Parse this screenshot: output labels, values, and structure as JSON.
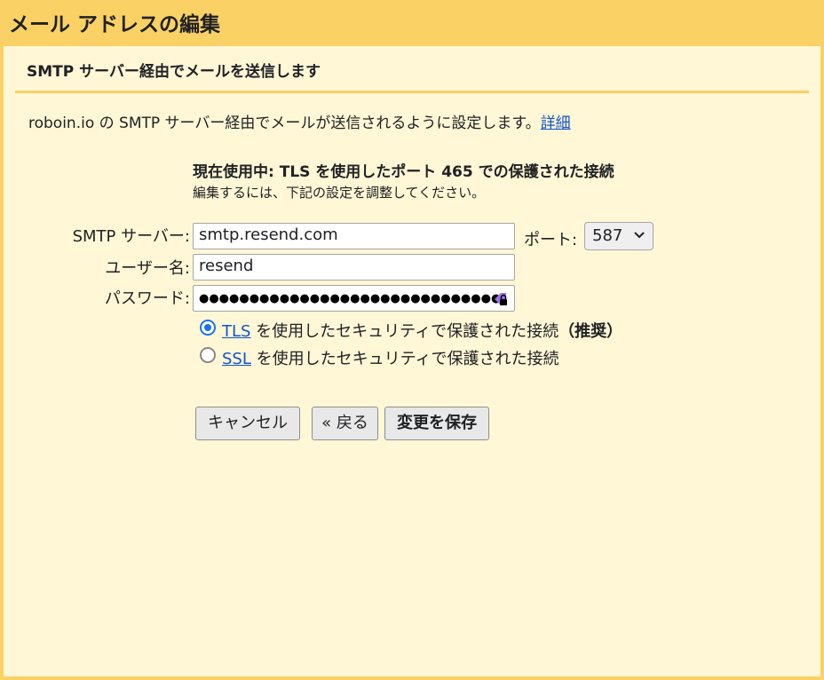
{
  "window": {
    "title": "メール アドレスの編集"
  },
  "section": {
    "title": "SMTP サーバー経由でメールを送信します"
  },
  "description": {
    "text": "roboin.io の SMTP サーバー経由でメールが送信されるように設定します。",
    "link": "詳細"
  },
  "status": {
    "current": "現在使用中: TLS を使用したポート 465 での保護された接続",
    "hint": "編集するには、下記の設定を調整してください。"
  },
  "form": {
    "smtp_label": "SMTP サーバー:",
    "smtp_value": "smtp.resend.com",
    "port_label": "ポート:",
    "port_value": "587",
    "user_label": "ユーザー名:",
    "user_value": "resend",
    "password_label": "パスワード:",
    "password_value": "●●●●●●●●●●●●●●●●●●●●●●●●●●●●●●"
  },
  "security": {
    "tls_link": "TLS",
    "tls_text": " を使用したセキュリティで保護された接続",
    "tls_recommended": "（推奨）",
    "ssl_link": "SSL",
    "ssl_text": " を使用したセキュリティで保護された接続",
    "selected": "TLS"
  },
  "buttons": {
    "cancel": "キャンセル",
    "back": "« 戻る",
    "save": "変更を保存"
  },
  "colors": {
    "header_bg": "#fad165",
    "panel_bg": "#fff7d6",
    "link": "#1155cc",
    "radio_accent": "#1a73e8"
  }
}
